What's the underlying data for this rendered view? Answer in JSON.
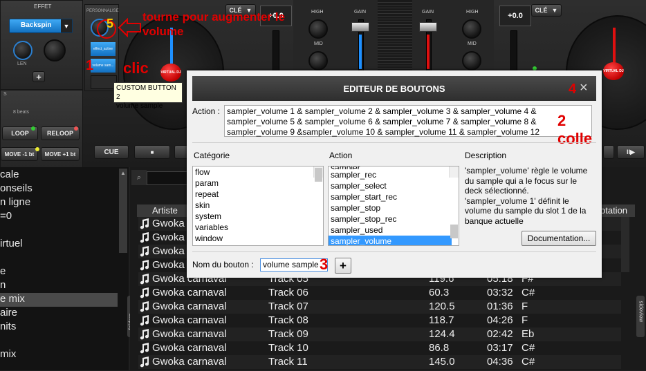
{
  "deck_left": {
    "effect_label": "EFFET",
    "effect_select": "Backspin",
    "len_label": "LEN",
    "plus_label": "+",
    "personalise_label": "PERSONNALISE",
    "custom_btn1": "effect_active",
    "custom_btn2": "volume sam...",
    "beats_label": "8 beats",
    "loop_label": "LOOP",
    "reloop_label": "RELOOP",
    "move_minus_label": "MOVE -1 bt",
    "move_plus_label": "MOVE +1 bt",
    "cue_label": "CUE",
    "stop_glyph": "■",
    "cle_label": "CLÉ",
    "cle_arrow": "▼",
    "gain_value": "+0.0",
    "s_label": "S",
    "turntable_label": "VIRTUAL DJ"
  },
  "mixer": {
    "high": "HIGH",
    "mid": "MID",
    "gain": "GAIN"
  },
  "deck_right": {
    "cle_label": "CLÉ",
    "cle_arrow": "▼",
    "gain_value": "+0.0",
    "play_glyph": "II▶",
    "turntable_label": "VIRTUAL DJ"
  },
  "tooltip": {
    "line1": "CUSTOM BUTTON 2",
    "line2": "volume sample"
  },
  "annotations": {
    "a5": "5",
    "a5_text": "tourne pour augmenter le volume",
    "a1": "1",
    "a1_text": "clic",
    "a4": "4",
    "a2": "2 colle",
    "a3": "3"
  },
  "dialog": {
    "title": "EDITEUR DE BOUTONS",
    "close": "×",
    "action_label": "Action :",
    "action_value": "sampler_volume 1 & sampler_volume 2 & sampler_volume 3 & sampler_volume 4 & sampler_volume 5 & sampler_volume 6 & sampler_volume 7 & sampler_volume 8 & sampler_volume 9 &sampler_volume 10 & sampler_volume 11 & sampler_volume 12",
    "category_header": "Catégorie",
    "action_header": "Action",
    "description_header": "Description",
    "categories": [
      "flow",
      "param",
      "repeat",
      "skin",
      "system",
      "variables",
      "window"
    ],
    "actions": [
      "sampler_rec",
      "sampler_select",
      "sampler_start_rec",
      "sampler_stop",
      "sampler_stop_rec",
      "sampler_used",
      "sampler_volume"
    ],
    "actions_partial_top": "sampler_",
    "selected_action": "sampler_volume",
    "description": "'sampler_volume' règle le volume du sample qui a le focus sur le deck sélectionné. 'sampler_volume 1' définit le volume du sample du slot 1 de la banque actuelle",
    "documentation_button": "Documentation...",
    "name_label": "Nom du bouton :",
    "name_value": "volume sample",
    "add_button": "+"
  },
  "browser_left": {
    "items": [
      "cale",
      "onseils",
      "n ligne",
      "=0",
      "",
      "irtuel",
      "",
      "e",
      "n",
      "e mix",
      "aire",
      "nits",
      "",
      "mix"
    ],
    "selected_index": 9,
    "folders_tab": "folders"
  },
  "browser_right": {
    "columns": {
      "artist": "Artiste",
      "rotation": "otation"
    },
    "sideview_tab": "sideview",
    "rows": [
      {
        "artist": "Gwoka",
        "title": "",
        "bpm": "",
        "length": "",
        "key": ""
      },
      {
        "artist": "Gwoka",
        "title": "",
        "bpm": "",
        "length": "",
        "key": ""
      },
      {
        "artist": "Gwoka",
        "title": "",
        "bpm": "",
        "length": "",
        "key": ""
      },
      {
        "artist": "Gwoka",
        "title": "",
        "bpm": "",
        "length": "",
        "key": ""
      },
      {
        "artist": "Gwoka carnaval",
        "title": "Track 05",
        "bpm": "119.6",
        "length": "05:18",
        "key": "F#"
      },
      {
        "artist": "Gwoka carnaval",
        "title": "Track 06",
        "bpm": "60.3",
        "length": "03:32",
        "key": "C#"
      },
      {
        "artist": "Gwoka carnaval",
        "title": "Track 07",
        "bpm": "120.5",
        "length": "01:36",
        "key": "F"
      },
      {
        "artist": "Gwoka carnaval",
        "title": "Track 08",
        "bpm": "118.7",
        "length": "04:26",
        "key": "F"
      },
      {
        "artist": "Gwoka carnaval",
        "title": "Track 09",
        "bpm": "124.4",
        "length": "02:42",
        "key": "Eb"
      },
      {
        "artist": "Gwoka carnaval",
        "title": "Track 10",
        "bpm": "86.8",
        "length": "03:17",
        "key": "C#"
      },
      {
        "artist": "Gwoka carnaval",
        "title": "Track 11",
        "bpm": "145.0",
        "length": "04:36",
        "key": "C#"
      }
    ]
  },
  "colors": {
    "accent_blue": "#1e90ff",
    "annotation_red": "#e10000",
    "selection_blue": "#3399ff",
    "turntable_red": "#cc0000"
  }
}
